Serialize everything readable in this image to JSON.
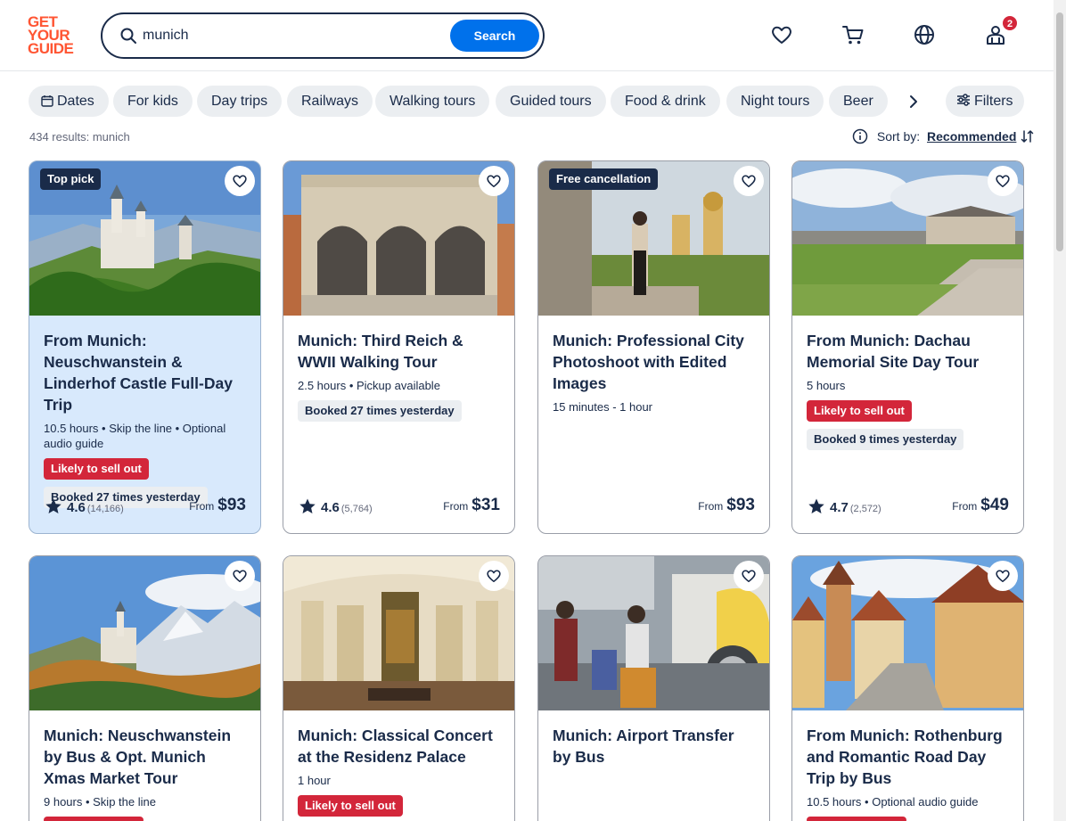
{
  "header": {
    "logo_lines": [
      "GET",
      "YOUR",
      "GUIDE"
    ],
    "search_value": "munich",
    "search_button": "Search",
    "icons": [
      "heart-icon",
      "cart-icon",
      "globe-icon",
      "profile-icon"
    ],
    "notification_count": "2"
  },
  "chips": [
    "Dates",
    "For kids",
    "Day trips",
    "Railways",
    "Walking tours",
    "Guided tours",
    "Food & drink",
    "Night tours",
    "Beer"
  ],
  "filters_label": "Filters",
  "results_text": "434 results: munich",
  "sort": {
    "label": "Sort by:",
    "value": "Recommended"
  },
  "colors": {
    "accent": "#0071eb",
    "brand": "#ff5533",
    "sellout": "#d3263a",
    "dark": "#1a2b49"
  },
  "cards": [
    {
      "tag": "Top pick",
      "title": "From Munich: Neuschwanstein & Linderhof Castle Full-Day Trip",
      "meta": "10.5 hours • Skip the line • Optional audio guide",
      "sell": "Likely to sell out",
      "booked": "Booked 27 times yesterday",
      "rating": "4.6",
      "reviews": "(14,166)",
      "from": "From",
      "price": "$93"
    },
    {
      "tag": "",
      "title": "Munich: Third Reich & WWII Walking Tour",
      "meta": "2.5 hours • Pickup available",
      "sell": "",
      "booked": "Booked 27 times yesterday",
      "rating": "4.6",
      "reviews": "(5,764)",
      "from": "From",
      "price": "$31"
    },
    {
      "tag": "Free cancellation",
      "title": "Munich: Professional City Photoshoot with Edited Images",
      "meta": "15 minutes - 1 hour",
      "sell": "",
      "booked": "",
      "rating": "",
      "reviews": "",
      "from": "From",
      "price": "$93"
    },
    {
      "tag": "",
      "title": "From Munich: Dachau Memorial Site Day Tour",
      "meta": "5 hours",
      "sell": "Likely to sell out",
      "booked": "Booked 9 times yesterday",
      "rating": "4.7",
      "reviews": "(2,572)",
      "from": "From",
      "price": "$49"
    },
    {
      "tag": "",
      "title": "Munich: Neuschwanstein by Bus & Opt. Munich Xmas Market Tour",
      "meta": "9 hours • Skip the line",
      "sell": "",
      "booked": "",
      "rating": "",
      "reviews": "",
      "from": "",
      "price": ""
    },
    {
      "tag": "",
      "title": "Munich: Classical Concert at the Residenz Palace",
      "meta": "1 hour",
      "sell": "Likely to sell out",
      "booked": "",
      "rating": "",
      "reviews": "",
      "from": "",
      "price": ""
    },
    {
      "tag": "",
      "title": "Munich: Airport Transfer by Bus",
      "meta": "",
      "sell": "",
      "booked": "",
      "rating": "",
      "reviews": "",
      "from": "",
      "price": ""
    },
    {
      "tag": "",
      "title": "From Munich: Rothenburg and Romantic Road Day Trip by Bus",
      "meta": "10.5 hours • Optional audio guide",
      "sell": "",
      "booked": "",
      "rating": "",
      "reviews": "",
      "from": "",
      "price": ""
    }
  ]
}
